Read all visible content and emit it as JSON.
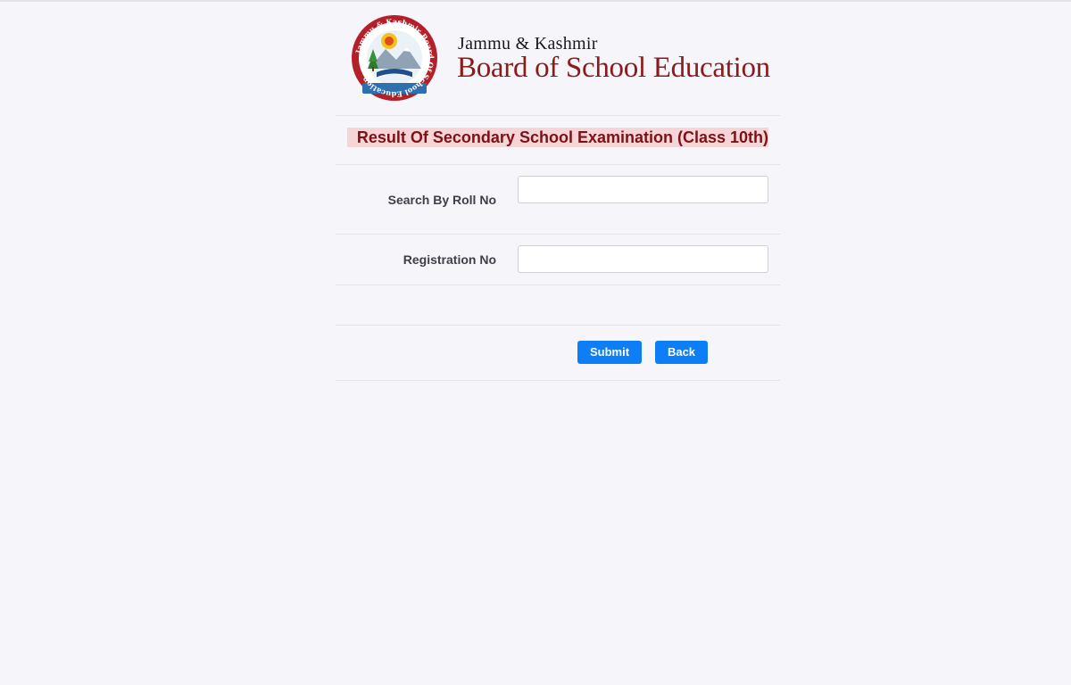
{
  "header": {
    "subtitle": "Jammu & Kashmir",
    "title": "Board of School Education",
    "logo_ring_text": "Jammu & Kashmir Board Of School Education"
  },
  "result": {
    "title": "Result Of Secondary School Examination (Class 10th)"
  },
  "form": {
    "roll_label": "Search By Roll No",
    "roll_value": "",
    "registration_label": "Registration No",
    "registration_value": ""
  },
  "buttons": {
    "submit_label": "Submit",
    "back_label": "Back"
  },
  "colors": {
    "brand_red": "#8b1a1a",
    "result_bg": "#f7d4d6",
    "button_blue": "#0d7ef5",
    "page_bg": "#f6f5fa"
  }
}
